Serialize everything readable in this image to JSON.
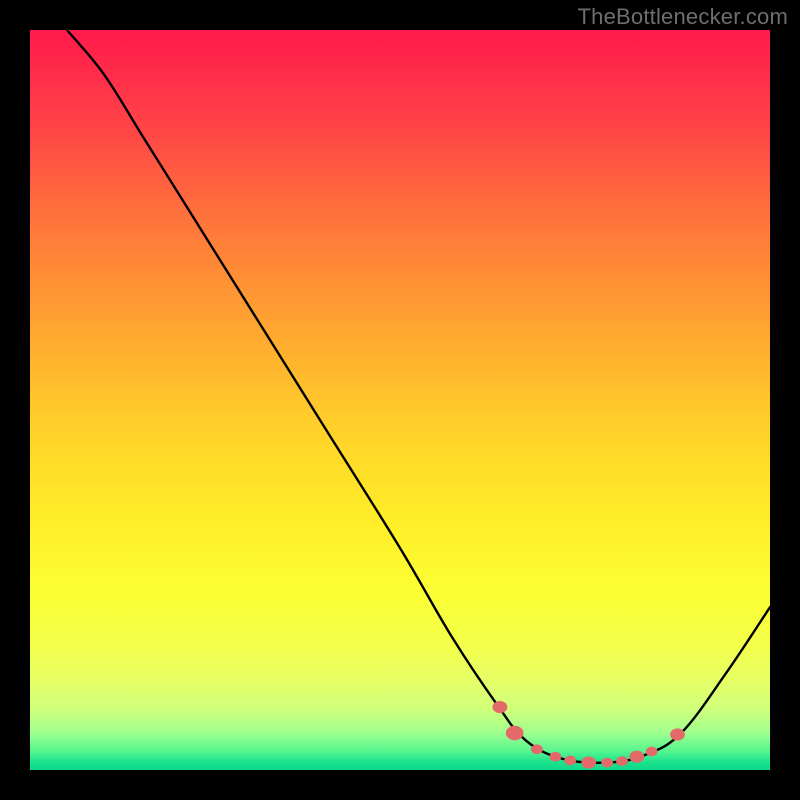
{
  "watermark": "TheBottlenecker.com",
  "chart_data": {
    "type": "line",
    "title": "",
    "xlabel": "",
    "ylabel": "",
    "xlim": [
      0,
      100
    ],
    "ylim": [
      0,
      100
    ],
    "series": [
      {
        "name": "curve",
        "points": [
          {
            "x": 5,
            "y": 100
          },
          {
            "x": 10,
            "y": 94
          },
          {
            "x": 15,
            "y": 86
          },
          {
            "x": 20,
            "y": 78
          },
          {
            "x": 30,
            "y": 62
          },
          {
            "x": 40,
            "y": 46
          },
          {
            "x": 50,
            "y": 30
          },
          {
            "x": 57,
            "y": 18
          },
          {
            "x": 63,
            "y": 9
          },
          {
            "x": 67,
            "y": 4
          },
          {
            "x": 72,
            "y": 1.5
          },
          {
            "x": 78,
            "y": 1
          },
          {
            "x": 83,
            "y": 2
          },
          {
            "x": 88,
            "y": 5
          },
          {
            "x": 94,
            "y": 13
          },
          {
            "x": 100,
            "y": 22
          }
        ]
      }
    ],
    "markers": [
      {
        "x": 63.5,
        "y": 8.5,
        "r": 1.0
      },
      {
        "x": 65.5,
        "y": 5.0,
        "r": 1.2
      },
      {
        "x": 68.5,
        "y": 2.8,
        "r": 0.8
      },
      {
        "x": 71.0,
        "y": 1.8,
        "r": 0.8
      },
      {
        "x": 73.0,
        "y": 1.3,
        "r": 0.8
      },
      {
        "x": 75.5,
        "y": 1.0,
        "r": 1.0
      },
      {
        "x": 78.0,
        "y": 1.0,
        "r": 0.8
      },
      {
        "x": 80.0,
        "y": 1.2,
        "r": 0.8
      },
      {
        "x": 82.0,
        "y": 1.8,
        "r": 1.0
      },
      {
        "x": 84.0,
        "y": 2.5,
        "r": 0.8
      },
      {
        "x": 87.5,
        "y": 4.8,
        "r": 1.0
      }
    ],
    "colors": {
      "curve": "#000000",
      "marker": "#e46a6a",
      "gradient_top": "#ff1a4b",
      "gradient_bottom": "#0fd98c",
      "background": "#000000",
      "watermark": "#6e6e6e"
    }
  }
}
